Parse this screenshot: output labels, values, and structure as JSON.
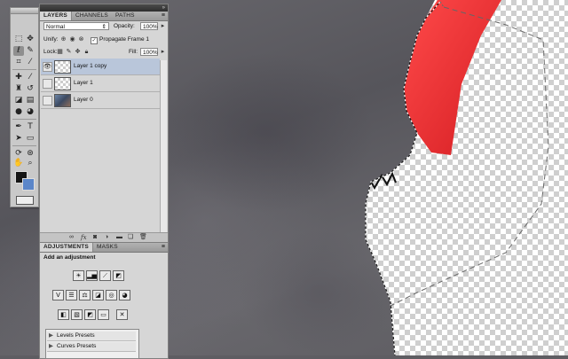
{
  "tools_panel": {
    "tools": [
      "marquee-tool",
      "move-tool",
      "lasso-tool",
      "quick-select-tool",
      "crop-tool",
      "eyedropper-tool",
      "healing-tool",
      "brush-tool",
      "clone-stamp-tool",
      "history-brush-tool",
      "eraser-tool",
      "gradient-tool",
      "blur-tool",
      "dodge-tool",
      "pen-tool",
      "type-tool",
      "path-select-tool",
      "shape-tool",
      "hand-tool",
      "zoom-tool",
      "3d-rotate-tool",
      "3d-orbit-tool"
    ],
    "foreground_color": "#151515",
    "background_color": "#5b86c9"
  },
  "layers_panel": {
    "tabs": [
      "LAYERS",
      "CHANNELS",
      "PATHS"
    ],
    "active_tab": "LAYERS",
    "blend_mode": "Normal",
    "opacity_label": "Opacity:",
    "opacity_value": "100%",
    "unify_label": "Unify:",
    "propagate_label": "Propagate Frame 1",
    "lock_label": "Lock:",
    "fill_label": "Fill:",
    "fill_value": "100%",
    "layers": [
      {
        "name": "Layer 1 copy",
        "visible": true,
        "selected": true,
        "thumb": "transparent"
      },
      {
        "name": "Layer 1",
        "visible": false,
        "selected": false,
        "thumb": "transparent"
      },
      {
        "name": "Layer 0",
        "visible": false,
        "selected": false,
        "thumb": "photo"
      }
    ],
    "footer_icons": [
      "link-icon",
      "fx-icon",
      "mask-icon",
      "adjustment-layer-icon",
      "group-icon",
      "new-layer-icon",
      "trash-icon"
    ]
  },
  "adjustments_panel": {
    "tabs": [
      "ADJUSTMENTS",
      "MASKS"
    ],
    "active_tab": "ADJUSTMENTS",
    "heading": "Add an adjustment",
    "presets": [
      "Levels Presets",
      "Curves Presets"
    ]
  },
  "canvas": {
    "layer_color": "#e3262a",
    "selection": "marching-ants"
  }
}
